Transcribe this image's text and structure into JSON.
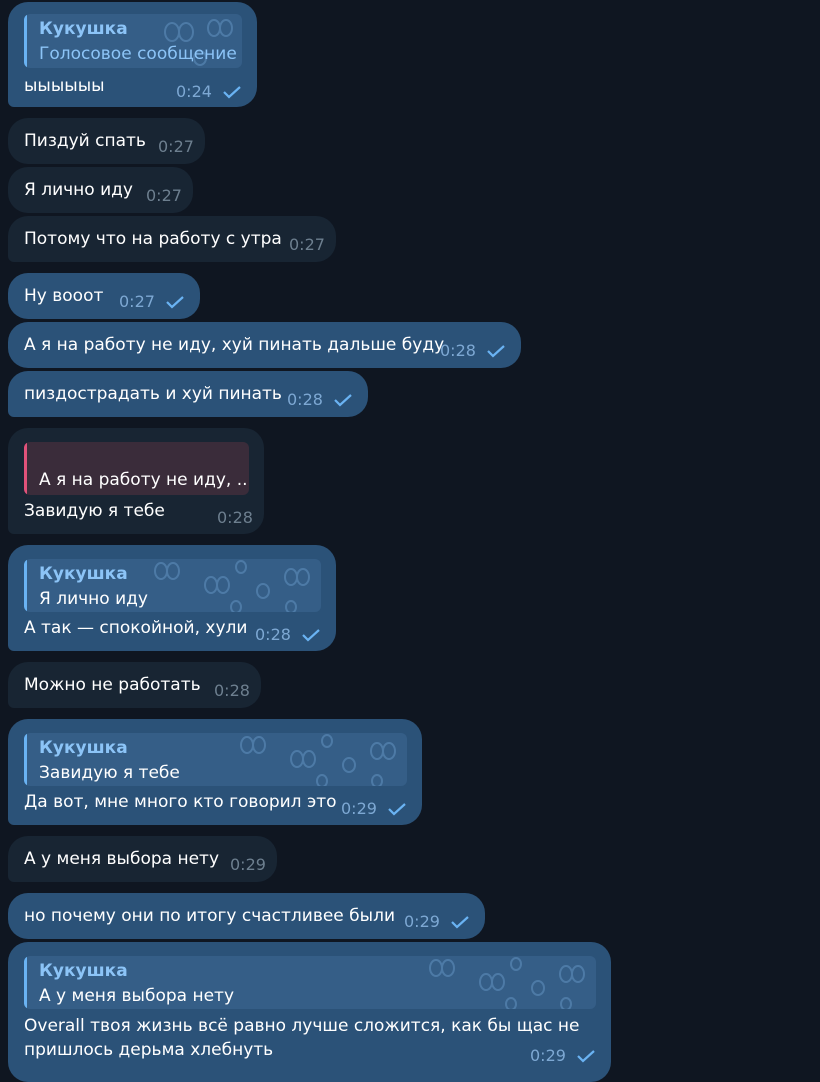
{
  "messages": [
    {
      "id": "m1",
      "dir": "out",
      "reply_name": "Кукушка",
      "reply_text": "Голосовое сообщение",
      "text": "ыыыыыы",
      "time": "0:24",
      "read": true
    },
    {
      "id": "m2",
      "dir": "in",
      "text": "Пиздуй спать",
      "time": "0:27"
    },
    {
      "id": "m3",
      "dir": "in",
      "text": "Я лично иду",
      "time": "0:27"
    },
    {
      "id": "m4",
      "dir": "in",
      "text": "Потому что на работу с утра",
      "time": "0:27"
    },
    {
      "id": "m5",
      "dir": "out",
      "text": "Ну вооот",
      "time": "0:27",
      "read": true
    },
    {
      "id": "m6",
      "dir": "out",
      "text": "А я на работу не иду, хуй пинать дальше буду",
      "time": "0:28",
      "read": true
    },
    {
      "id": "m7",
      "dir": "out",
      "text": "пиздострадать и хуй пинать",
      "time": "0:28",
      "read": true
    },
    {
      "id": "m8",
      "dir": "in",
      "reply_text": "А я на работу не иду, ...",
      "text": "Завидую я тебе",
      "time": "0:28"
    },
    {
      "id": "m9",
      "dir": "out",
      "reply_name": "Кукушка",
      "reply_text": "Я лично иду",
      "text": "А так — спокойной, хули",
      "time": "0:28",
      "read": true
    },
    {
      "id": "m10",
      "dir": "in",
      "text": "Можно не работать",
      "time": "0:28"
    },
    {
      "id": "m11",
      "dir": "out",
      "reply_name": "Кукушка",
      "reply_text": "Завидую я тебе",
      "text": "Да вот, мне много кто говорил это",
      "time": "0:29",
      "read": true
    },
    {
      "id": "m12",
      "dir": "in",
      "text": "А у меня выбора нету",
      "time": "0:29"
    },
    {
      "id": "m13",
      "dir": "out",
      "text": "но почему они по итогу счастливее были",
      "time": "0:29",
      "read": true
    },
    {
      "id": "m14",
      "dir": "out",
      "reply_name": "Кукушка",
      "reply_text": "А у меня выбора нету",
      "text": "Overall твоя жизнь всё равно лучше сложится, как бы щас не пришлось дерьма хлебнуть",
      "time": "0:29",
      "read": true
    }
  ],
  "colors": {
    "background": "#0f1621",
    "outgoing": "#2b5278",
    "incoming": "#182533",
    "accent": "#6ab3f3",
    "reply_pink": "#e0527a"
  },
  "icons": {
    "read": "double-check-icon",
    "sticker_pattern": "sticker-pattern-icon"
  }
}
